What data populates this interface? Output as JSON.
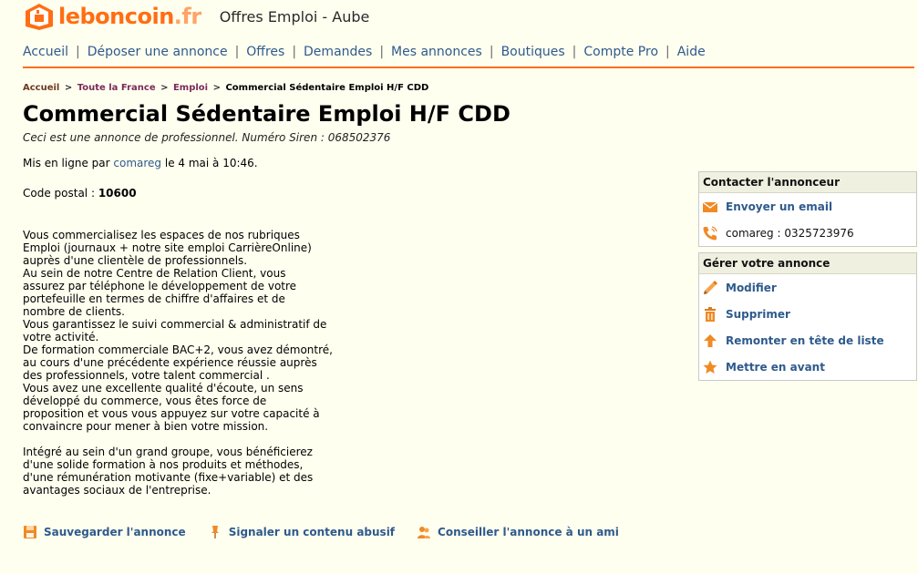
{
  "header": {
    "logo_name": "leboncoin",
    "logo_tld": ".fr",
    "subtitle": "Offres Emploi - Aube"
  },
  "nav": {
    "items": [
      {
        "label": "Accueil"
      },
      {
        "label": "Déposer une annonce"
      },
      {
        "label": "Offres"
      },
      {
        "label": "Demandes"
      },
      {
        "label": "Mes annonces"
      },
      {
        "label": "Boutiques"
      },
      {
        "label": "Compte Pro"
      },
      {
        "label": "Aide"
      }
    ],
    "separator": "|"
  },
  "breadcrumb": {
    "items": [
      {
        "label": "Accueil"
      },
      {
        "label": "Toute la France"
      },
      {
        "label": "Emploi"
      }
    ],
    "separator": ">",
    "current": "Commercial Sédentaire Emploi H/F CDD"
  },
  "ad": {
    "title": "Commercial Sédentaire Emploi H/F CDD",
    "pro_note": "Ceci est une annonce de professionnel. Numéro Siren : 068502376",
    "posted_prefix": "Mis en ligne par",
    "author": "comareg",
    "posted_date": "le 4 mai à 10:46.",
    "postal_label": "Code postal :",
    "postal_code": "10600",
    "description_p1": "Vous commercialisez les espaces de nos rubriques\nEmploi (journaux + notre site emploi CarrièreOnline)\nauprès d'une clientèle de professionnels.\nAu sein de notre Centre de Relation Client, vous\nassurez par téléphone le développement de votre\nportefeuille en termes de chiffre d'affaires et de\nnombre de clients.\nVous garantissez le suivi commercial & administratif de\nvotre activité.\nDe formation commerciale BAC+2, vous avez démontré,\nau cours d'une précédente expérience réussie auprès\ndes professionnels, votre talent commercial .\nVous avez une excellente qualité d'écoute, un sens\ndéveloppé du commerce, vous êtes force de\nproposition et vous vous appuyez sur votre capacité à\nconvaincre pour mener à bien votre mission.",
    "description_p2": "Intégré au sein d'un grand groupe, vous bénéficierez\nd'une solide formation à nos produits et méthodes,\nd'une rémunération motivante (fixe+variable) et des\navantages sociaux de l'entreprise."
  },
  "contact_box": {
    "title": "Contacter l'annonceur",
    "email_label": "Envoyer un email",
    "phone_label": "comareg : 0325723976"
  },
  "manage_box": {
    "title": "Gérer votre annonce",
    "modify": "Modifier",
    "delete": "Supprimer",
    "bump": "Remonter en tête de liste",
    "feature": "Mettre en avant"
  },
  "bottom_actions": {
    "save": "Sauvegarder l'annonce",
    "report": "Signaler un contenu abusif",
    "share": "Conseiller l'annonce à un ami"
  },
  "colors": {
    "brand_orange": "#ff6e14",
    "link_blue": "#2e5a8c",
    "background": "#fffff0"
  }
}
